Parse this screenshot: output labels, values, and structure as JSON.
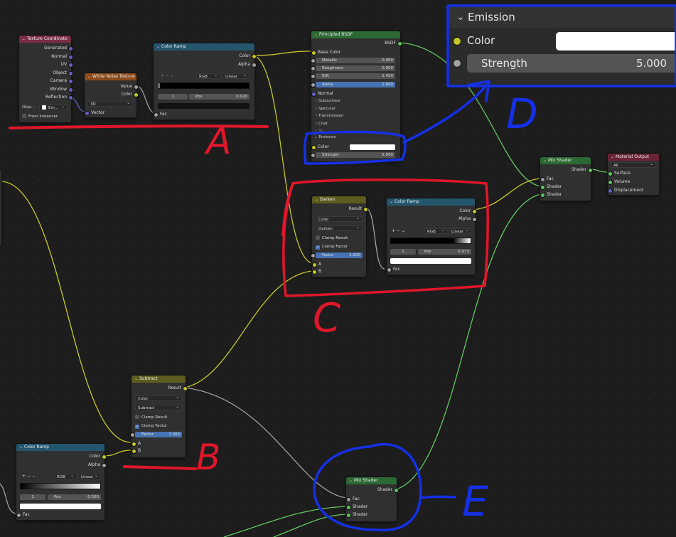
{
  "texture_coordinate": {
    "title": "Texture Coordinate",
    "outputs": [
      "Generated",
      "Normal",
      "UV",
      "Object",
      "Camera",
      "Window",
      "Reflection"
    ],
    "object_label": "Obje...",
    "object_value": "Em...",
    "from_instancer": "From Instancer"
  },
  "white_noise": {
    "title": "White Noise Texture",
    "outputs": [
      "Value",
      "Color"
    ],
    "dimension": "3D",
    "input": "Vector"
  },
  "color_ramp_top": {
    "title": "Color Ramp",
    "outputs": [
      "Color",
      "Alpha"
    ],
    "tools": "+ − ⌄",
    "mode": "RGB",
    "interp": "Linear",
    "stop_index": "1",
    "pos_label": "Pos",
    "pos_value": "0.020",
    "input": "Fac"
  },
  "principled": {
    "title": "Principled BSDF",
    "output": "BSDF",
    "base_color": "Base Color",
    "fields": [
      {
        "label": "Metallic",
        "value": "0.000"
      },
      {
        "label": "Roughness",
        "value": "0.000"
      },
      {
        "label": "IOR",
        "value": "1.450"
      },
      {
        "label": "Alpha",
        "value": "1.000"
      }
    ],
    "normal": "Normal",
    "panels": [
      "Subsurface",
      "Specular",
      "Transmission",
      "Coat",
      "Sh..."
    ],
    "emission_title": "Emission",
    "emission_color": "Color",
    "emission_strength_label": "Strength",
    "emission_strength_value": "5.000"
  },
  "emission_zoom": {
    "title": "Emission",
    "color_label": "Color",
    "strength_label": "Strength",
    "strength_value": "5.000"
  },
  "mix_shader_top": {
    "title": "Mix Shader",
    "output": "Shader",
    "inputs": [
      "Fac",
      "Shader",
      "Shader"
    ]
  },
  "material_output": {
    "title": "Material Output",
    "target": "All",
    "inputs": [
      "Surface",
      "Volume",
      "Displacement"
    ]
  },
  "darken": {
    "title": "Darken",
    "output": "Result",
    "type": "Color",
    "blend": "Darken",
    "clamp_result": "Clamp Result",
    "clamp_factor": "Clamp Factor",
    "factor_label": "Factor",
    "factor_value": "1.000",
    "inputs": [
      "A",
      "B"
    ]
  },
  "color_ramp_mid": {
    "title": "Color Ramp",
    "outputs": [
      "Color",
      "Alpha"
    ],
    "tools": "+ − ⌄",
    "mode": "RGB",
    "interp": "Linear",
    "stop_index": "1",
    "pos_label": "Pos",
    "pos_value": "0.973",
    "input": "Fac"
  },
  "subtract": {
    "title": "Subtract",
    "output": "Result",
    "type": "Color",
    "blend": "Subtract",
    "clamp_result": "Clamp Result",
    "clamp_factor": "Clamp Factor",
    "factor_label": "Factor",
    "factor_value": "1.000",
    "inputs": [
      "A",
      "B"
    ]
  },
  "color_ramp_bottom": {
    "title": "Color Ramp",
    "outputs": [
      "Color",
      "Alpha"
    ],
    "tools": "+ − ⌄",
    "mode": "RGB",
    "interp": "Linear",
    "stop_index": "1",
    "pos_label": "Pos",
    "pos_value": "0.500",
    "input": "Fac"
  },
  "mix_shader_bottom": {
    "title": "Mix Shader",
    "output": "Shader",
    "inputs": [
      "Fac",
      "Shader",
      "Shader"
    ]
  },
  "annotations": {
    "a": "A",
    "b": "B",
    "c": "C",
    "d": "D",
    "e": "E",
    "red": "#e0162b",
    "blue": "#1530e6"
  },
  "colors": {
    "background": "#1d1d1d",
    "node_body": "#303030",
    "socket_color": "#c7c729",
    "socket_float": "#a1a1a1",
    "socket_vector": "#6363c7",
    "socket_shader": "#63c763",
    "field_active": "#4772b3"
  }
}
